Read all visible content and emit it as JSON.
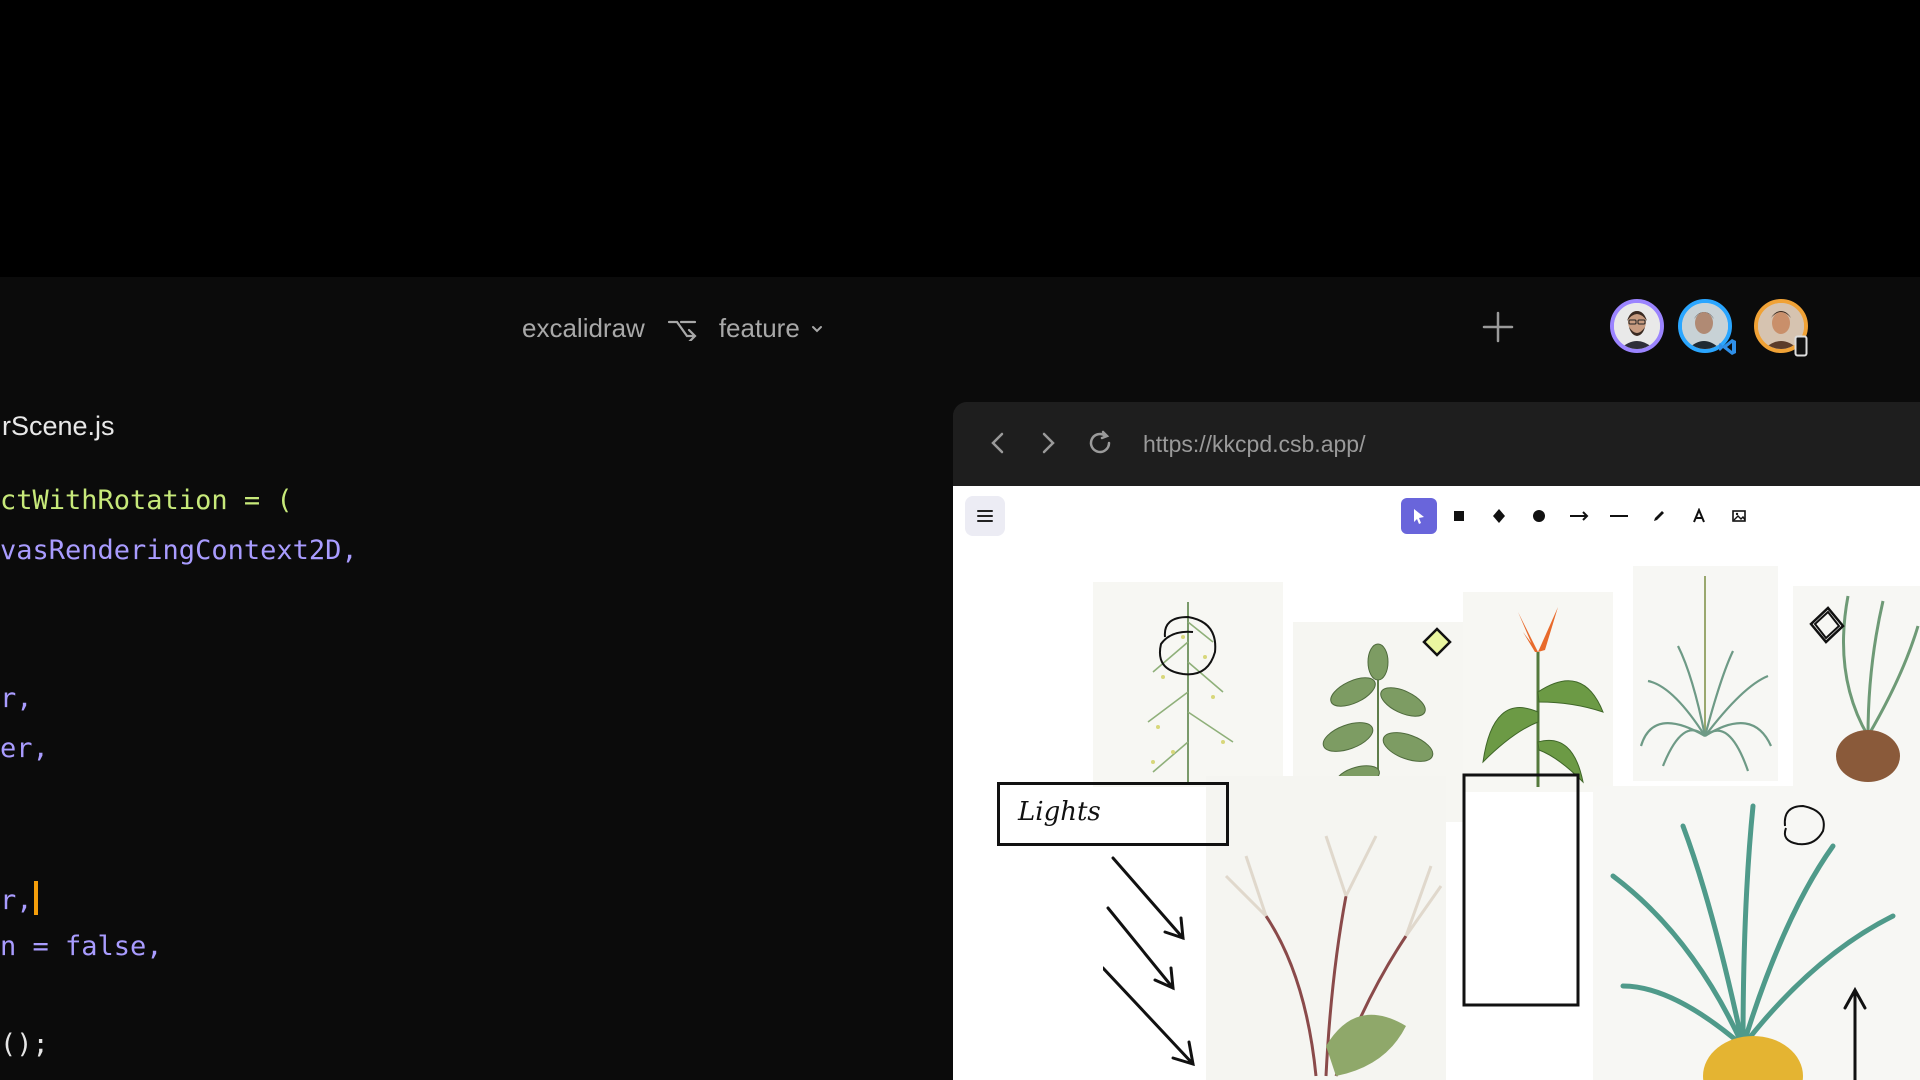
{
  "topbar": {
    "project_name": "excalidraw",
    "branch_icon": "branch-merge-icon",
    "branch_name": "feature",
    "add_icon": "plus-icon",
    "collaborators": [
      {
        "name": "avatar-1",
        "ring": "#9b84ff"
      },
      {
        "name": "avatar-2",
        "ring": "#2aa6ff",
        "badge": "vscode-icon"
      },
      {
        "name": "avatar-3",
        "ring": "#f0a236",
        "badge": "mobile-icon"
      }
    ]
  },
  "editor": {
    "file_name": "rScene.js",
    "lines": [
      "ctWithRotation = (",
      "vasRenderingContext2D,",
      "r,",
      "er,",
      "r,",
      "n = false,",
      "();"
    ]
  },
  "browser": {
    "url": "https://kkcpd.csb.app/",
    "back_icon": "chevron-left-icon",
    "forward_icon": "chevron-right-icon",
    "reload_icon": "reload-icon"
  },
  "canvas": {
    "menu_icon": "hamburger-menu-icon",
    "tools": [
      "selection-icon",
      "rectangle-icon",
      "diamond-icon",
      "ellipse-icon",
      "arrow-icon",
      "line-icon",
      "pencil-icon",
      "text-icon",
      "image-icon"
    ],
    "label_text": "Lights",
    "colors": {
      "accent": "#6965db",
      "highlight_diamond": "#eaf6a0"
    }
  }
}
